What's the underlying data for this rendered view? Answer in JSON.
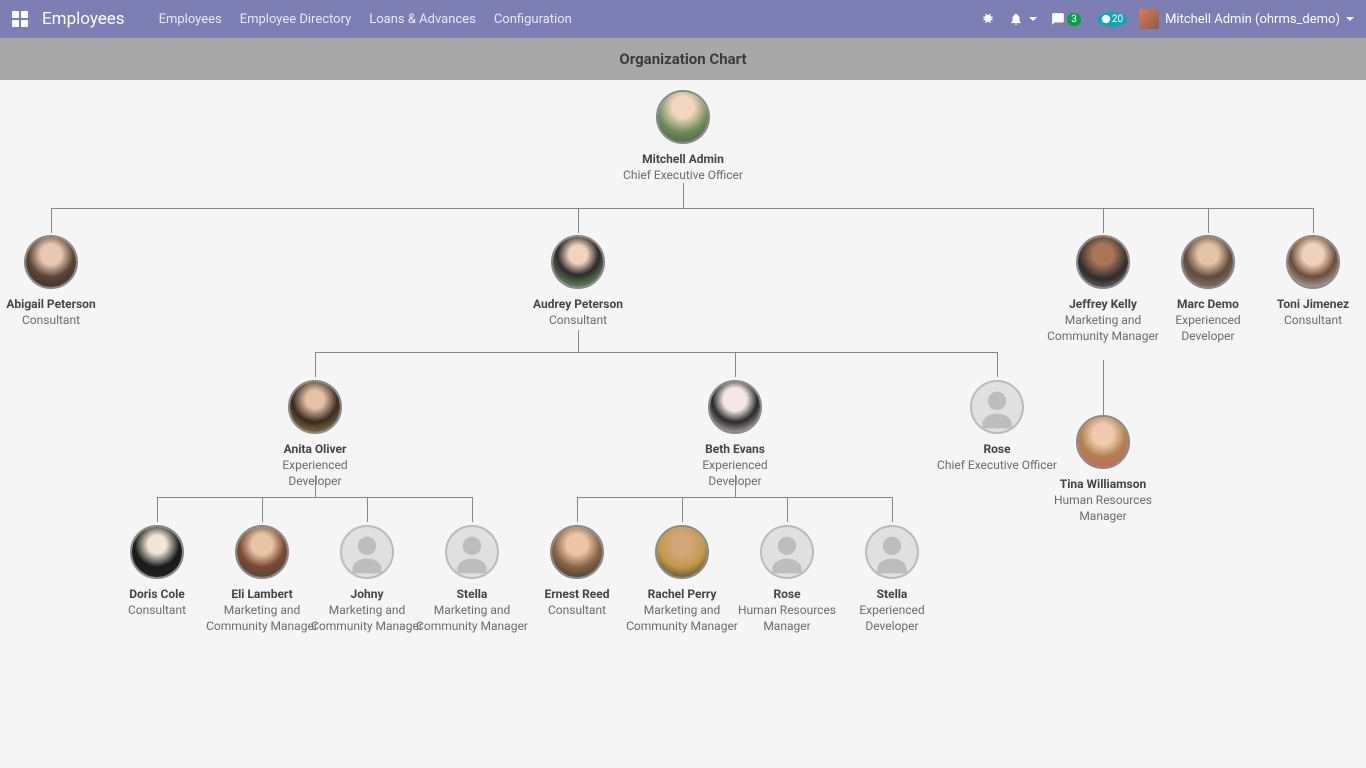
{
  "header": {
    "app_title": "Employees",
    "nav": [
      "Employees",
      "Employee Directory",
      "Loans & Advances",
      "Configuration"
    ],
    "messages_badge": "3",
    "activities_badge": "20",
    "user_display": "Mitchell Admin (ohrms_demo)"
  },
  "page_title": "Organization Chart",
  "org": {
    "root": {
      "name": "Mitchell Admin",
      "role": "Chief Executive Officer",
      "avatar": "photo-mitchell"
    },
    "level2": [
      {
        "name": "Abigail Peterson",
        "role": "Consultant",
        "avatar": "photo-abigail"
      },
      {
        "name": "Audrey Peterson",
        "role": "Consultant",
        "avatar": "photo-audrey"
      },
      {
        "name": "Jeffrey Kelly",
        "role": "Marketing and Community Manager",
        "avatar": "photo-jeffrey"
      },
      {
        "name": "Marc Demo",
        "role": "Experienced Developer",
        "avatar": "photo-marc"
      },
      {
        "name": "Toni Jimenez",
        "role": "Consultant",
        "avatar": "photo-toni"
      }
    ],
    "audrey_children": [
      {
        "name": "Anita Oliver",
        "role": "Experienced Developer",
        "avatar": "photo-anita"
      },
      {
        "name": "Beth Evans",
        "role": "Experienced Developer",
        "avatar": "photo-beth"
      },
      {
        "name": "Rose",
        "role": "Chief Executive Officer",
        "avatar": "placeholder"
      }
    ],
    "anita_children": [
      {
        "name": "Doris Cole",
        "role": "Consultant",
        "avatar": "photo-doris"
      },
      {
        "name": "Eli Lambert",
        "role": "Marketing and Community Manager",
        "avatar": "photo-eli"
      },
      {
        "name": "Johny",
        "role": "Marketing and Community Manager",
        "avatar": "placeholder"
      },
      {
        "name": "Stella",
        "role": "Marketing and Community Manager",
        "avatar": "placeholder"
      }
    ],
    "beth_children": [
      {
        "name": "Ernest Reed",
        "role": "Consultant",
        "avatar": "photo-ernest"
      },
      {
        "name": "Rachel Perry",
        "role": "Marketing and Community Manager",
        "avatar": "photo-rachel"
      },
      {
        "name": "Rose",
        "role": "Human Resources Manager",
        "avatar": "placeholder"
      },
      {
        "name": "Stella",
        "role": "Experienced Developer",
        "avatar": "placeholder"
      }
    ],
    "jeffrey_children": [
      {
        "name": "Tina Williamson",
        "role": "Human Resources Manager",
        "avatar": "photo-tina"
      }
    ]
  },
  "avatar_gradients": {
    "photo-mitchell": "radial-gradient(circle at 50% 30%, #f3d6c0 25%, #6b8a5a 60%, #3d5a34 100%)",
    "photo-abigail": "radial-gradient(circle at 50% 35%, #e8c8b0 25%, #5a4436 55%, #342a22 100%)",
    "photo-audrey": "radial-gradient(circle at 50% 35%, #f2d4bb 22%, #2b2b2b 50%, #8fb87a 100%)",
    "photo-jeffrey": "radial-gradient(circle at 50% 35%, #a87657 25%, #2d2d2d 60%, #828282 100%)",
    "photo-marc": "radial-gradient(circle at 50% 35%, #e4c2a4 25%, #5f4a3a 55%, #9a8b7a 100%)",
    "photo-toni": "radial-gradient(circle at 50% 35%, #f0d2bc 25%, #6b4c3a 55%, #d0d0d0 100%)",
    "photo-anita": "radial-gradient(circle at 50% 35%, #e6c2a4 22%, #3a2a1e 55%, #b09a58 100%)",
    "photo-beth": "radial-gradient(circle at 50% 35%, #f6e6e8 28%, #2a2a2a 55%, #f2e2e6 100%)",
    "photo-doris": "radial-gradient(circle at 50% 35%, #f2e6d8 22%, #1a1a1a 55%, #2a2a2a 100%)",
    "photo-eli": "radial-gradient(circle at 50% 35%, #e8c4a6 25%, #7a4a32 55%, #444 100%)",
    "photo-ernest": "radial-gradient(circle at 50% 35%, #eac6a6 25%, #8a6448 55%, #2a2a2a 100%)",
    "photo-rachel": "radial-gradient(circle at 50% 35%, #d2a67a 22%, #c49a4a 55%, #2a2a2a 100%)",
    "photo-tina": "radial-gradient(circle at 50% 35%, #f0cab0 25%, #b08050 55%, #d85a5a 100%)"
  }
}
